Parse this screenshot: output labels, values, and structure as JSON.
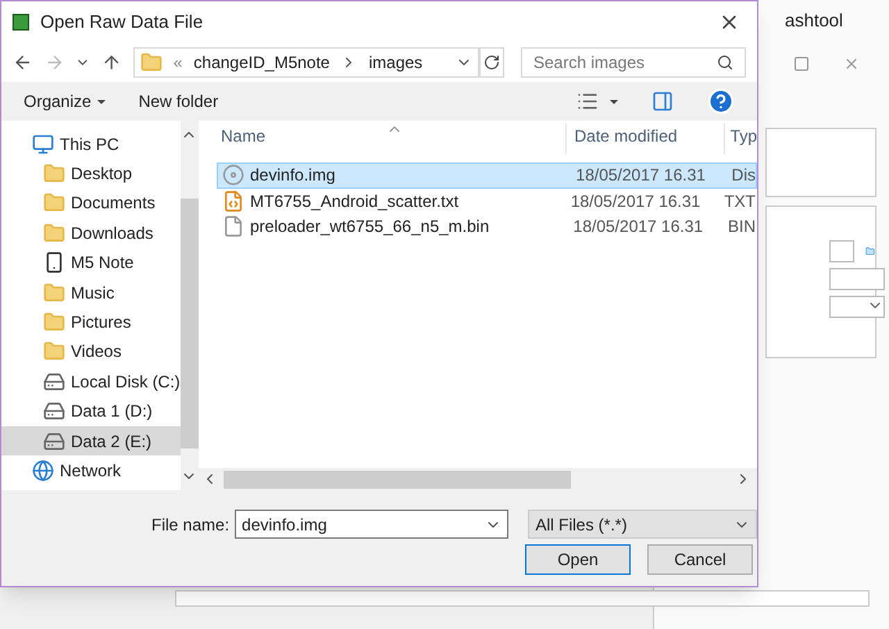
{
  "background_window": {
    "title": "ashtool"
  },
  "dialog": {
    "title": "Open Raw Data File",
    "breadcrumb": {
      "overflow": "«",
      "parts": [
        "changeID_M5note",
        "images"
      ]
    },
    "search": {
      "placeholder": "Search images"
    },
    "toolbar": {
      "organize": "Organize",
      "new_folder": "New folder"
    },
    "nav": [
      {
        "label": "This PC",
        "kind": "pc",
        "selected": false
      },
      {
        "label": "Desktop",
        "kind": "folder",
        "selected": false
      },
      {
        "label": "Documents",
        "kind": "folder",
        "selected": false
      },
      {
        "label": "Downloads",
        "kind": "folder",
        "selected": false
      },
      {
        "label": "M5 Note",
        "kind": "phone",
        "selected": false
      },
      {
        "label": "Music",
        "kind": "folder",
        "selected": false
      },
      {
        "label": "Pictures",
        "kind": "folder",
        "selected": false
      },
      {
        "label": "Videos",
        "kind": "folder",
        "selected": false
      },
      {
        "label": "Local Disk (C:)",
        "kind": "drive",
        "selected": false
      },
      {
        "label": "Data 1 (D:)",
        "kind": "drive",
        "selected": false
      },
      {
        "label": "Data 2 (E:)",
        "kind": "drive",
        "selected": true
      },
      {
        "label": "Network",
        "kind": "network",
        "selected": false
      }
    ],
    "columns": [
      "Name",
      "Date modified",
      "Typ"
    ],
    "files": [
      {
        "name": "devinfo.img",
        "kind": "disc",
        "date": "18/05/2017 16.31",
        "type": "Dis",
        "selected": true
      },
      {
        "name": "MT6755_Android_scatter.txt",
        "kind": "script",
        "date": "18/05/2017 16.31",
        "type": "TXT",
        "selected": false
      },
      {
        "name": "preloader_wt6755_66_n5_m.bin",
        "kind": "file",
        "date": "18/05/2017 16.31",
        "type": "BIN",
        "selected": false
      }
    ],
    "file_name": {
      "label": "File name:",
      "value": "devinfo.img"
    },
    "file_type": "All Files (*.*)",
    "buttons": {
      "open": "Open",
      "cancel": "Cancel"
    }
  }
}
